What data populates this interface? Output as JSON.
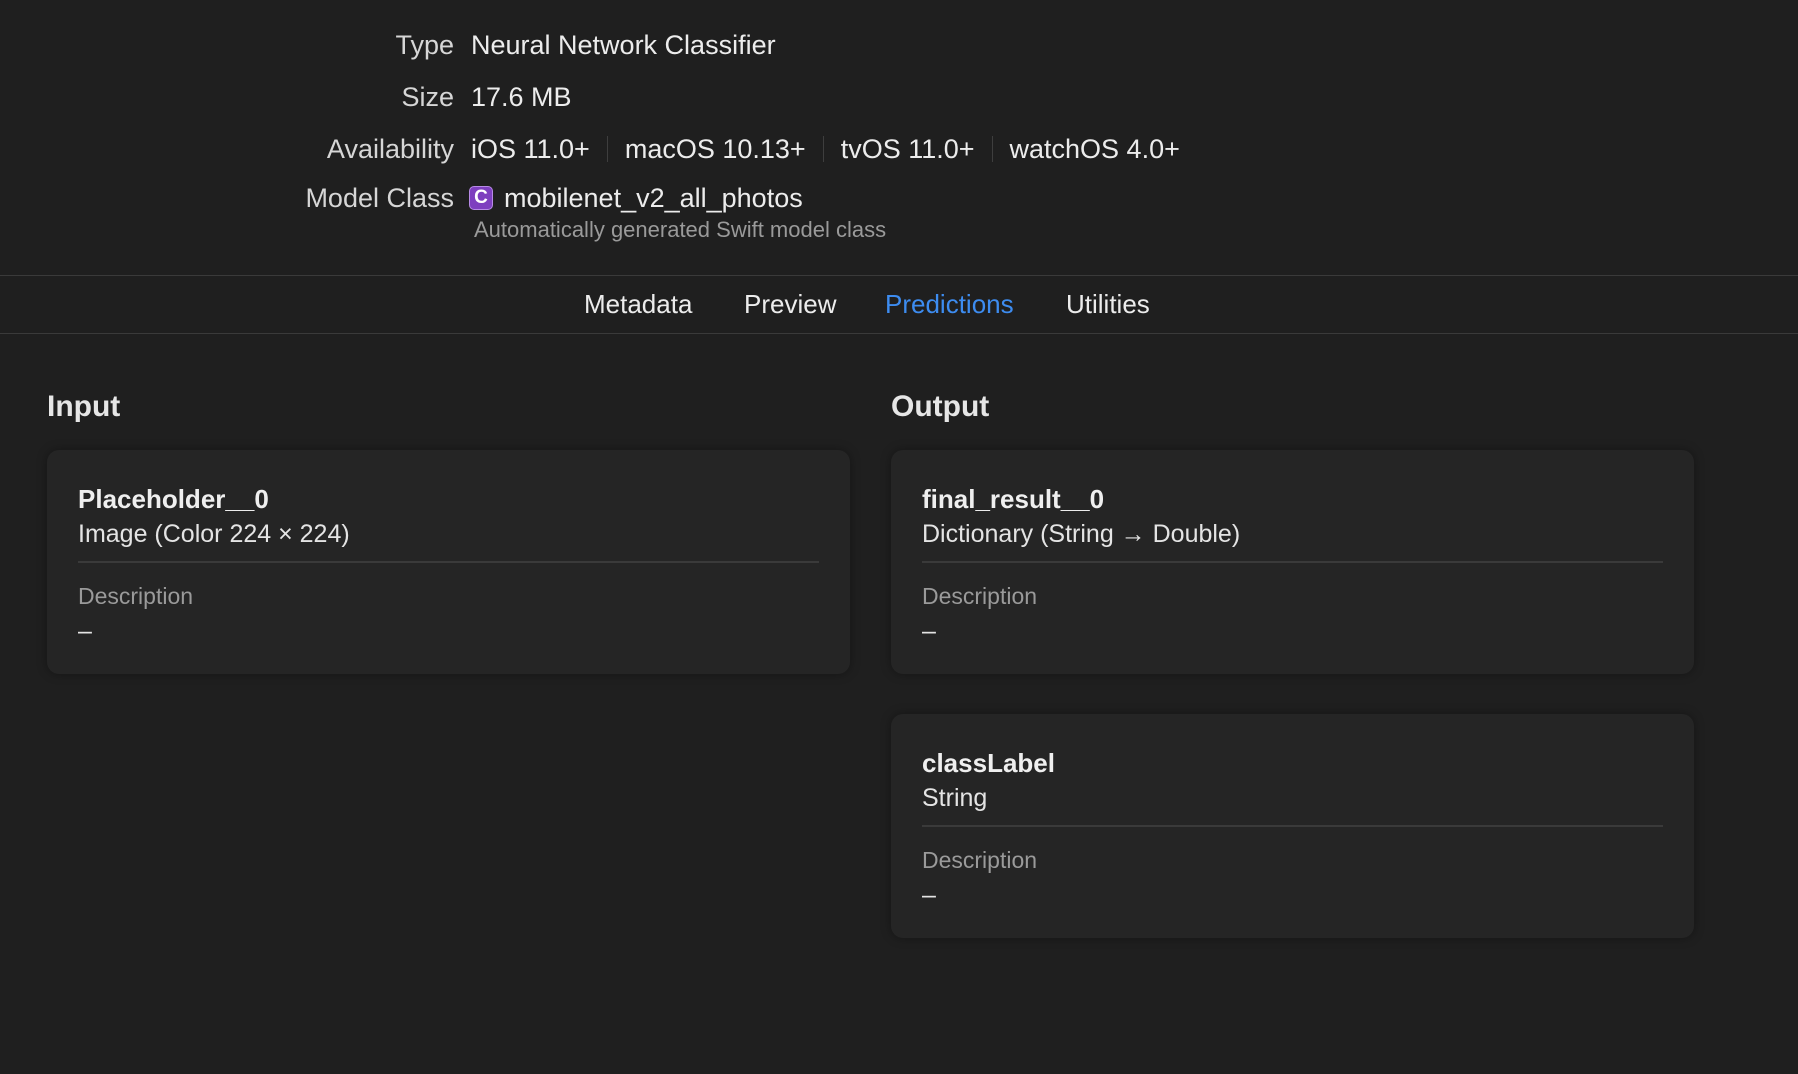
{
  "info": {
    "type_label": "Type",
    "type_value": "Neural Network Classifier",
    "size_label": "Size",
    "size_value": "17.6 MB",
    "availability_label": "Availability",
    "platforms": [
      "iOS 11.0+",
      "macOS 10.13+",
      "tvOS 11.0+",
      "watchOS 4.0+"
    ],
    "model_class_label": "Model Class",
    "model_class_icon": "C",
    "model_class_value": "mobilenet_v2_all_photos",
    "model_class_subtitle": "Automatically generated Swift model class"
  },
  "tabs": [
    {
      "label": "Metadata"
    },
    {
      "label": "Preview"
    },
    {
      "label": "Predictions"
    },
    {
      "label": "Utilities"
    }
  ],
  "active_tab": "Predictions",
  "input": {
    "title": "Input",
    "features": [
      {
        "name": "Placeholder__0",
        "type": "Image (Color 224 × 224)",
        "desc_label": "Description",
        "desc_value": "–"
      }
    ]
  },
  "output": {
    "title": "Output",
    "features": [
      {
        "name": "final_result__0",
        "type": "Dictionary (String → Double)",
        "desc_label": "Description",
        "desc_value": "–"
      },
      {
        "name": "classLabel",
        "type": "String",
        "desc_label": "Description",
        "desc_value": "–"
      }
    ]
  },
  "colors": {
    "background": "#1f1f1f",
    "card": "#252525",
    "accent": "#3d8cf0",
    "class_icon": "#7e3fbf"
  }
}
